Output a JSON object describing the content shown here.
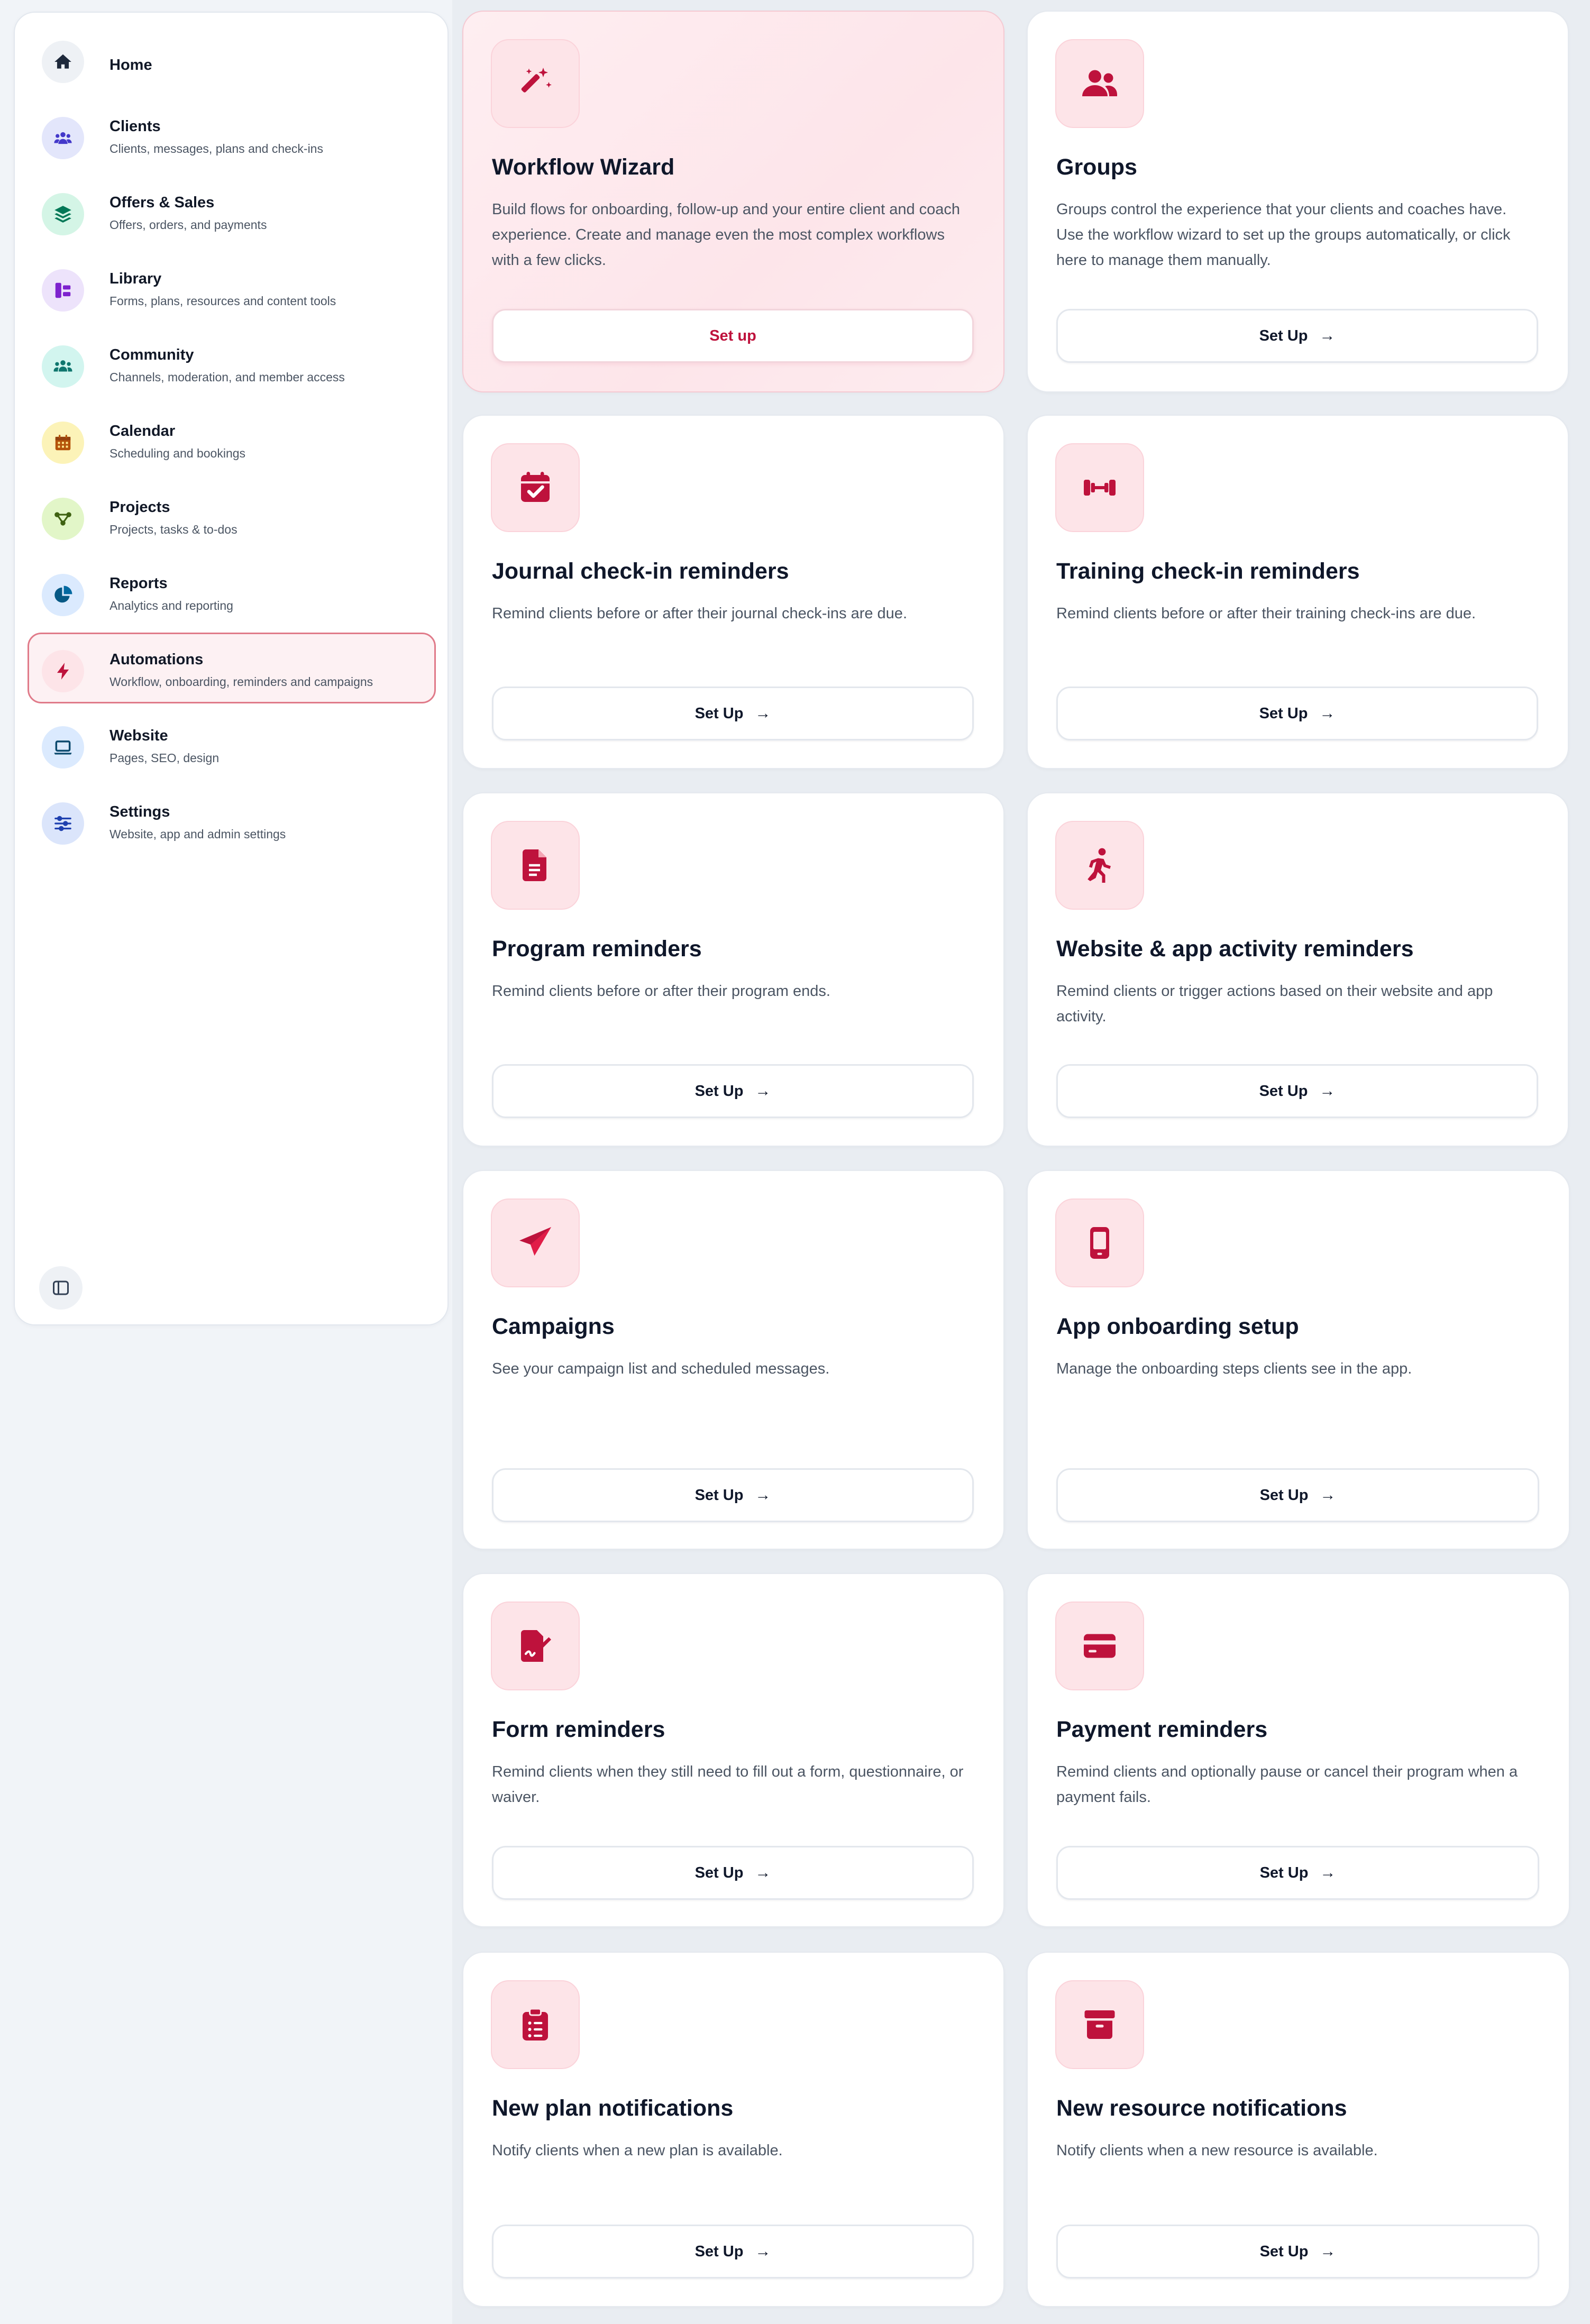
{
  "colors": {
    "accent": "#c8102e",
    "accent_soft": "#fde4e8",
    "active_border": "#e07a89"
  },
  "sidebar": {
    "items": [
      {
        "title": "Home",
        "subtitle": "",
        "icon": "home-icon"
      },
      {
        "title": "Clients",
        "subtitle": "Clients, messages, plans and check-ins",
        "icon": "users-icon"
      },
      {
        "title": "Offers & Sales",
        "subtitle": "Offers, orders, and payments",
        "icon": "layers-icon"
      },
      {
        "title": "Library",
        "subtitle": "Forms, plans, resources and content tools",
        "icon": "library-icon"
      },
      {
        "title": "Community",
        "subtitle": "Channels, moderation, and member access",
        "icon": "community-icon"
      },
      {
        "title": "Calendar",
        "subtitle": "Scheduling and bookings",
        "icon": "calendar-icon"
      },
      {
        "title": "Projects",
        "subtitle": "Projects, tasks & to-dos",
        "icon": "projects-icon"
      },
      {
        "title": "Reports",
        "subtitle": "Analytics and reporting",
        "icon": "pie-chart-icon"
      },
      {
        "title": "Automations",
        "subtitle": "Workflow, onboarding, reminders and campaigns",
        "icon": "bolt-icon"
      },
      {
        "title": "Website",
        "subtitle": "Pages, SEO, design",
        "icon": "laptop-icon"
      },
      {
        "title": "Settings",
        "subtitle": "Website, app and admin settings",
        "icon": "sliders-icon"
      }
    ],
    "active": "Automations"
  },
  "cards": [
    {
      "title": "Workflow Wizard",
      "description": "Build flows for onboarding, follow-up and your entire client and coach experience. Create and manage even the most complex workflows with a few clicks.",
      "button": "Set up",
      "icon": "magic-wand-icon"
    },
    {
      "title": "Groups",
      "description": "Groups control the experience that your clients and coaches have. Use the workflow wizard to set up the groups automatically, or click here to manage them manually.",
      "button": "Set Up",
      "icon": "user-group-icon"
    },
    {
      "title": "Journal check-in reminders",
      "description": "Remind clients before or after their journal check-ins are due.",
      "button": "Set Up",
      "icon": "calendar-check-icon"
    },
    {
      "title": "Training check-in reminders",
      "description": "Remind clients before or after their training check-ins are due.",
      "button": "Set Up",
      "icon": "dumbbell-icon"
    },
    {
      "title": "Program reminders",
      "description": "Remind clients before or after their program ends.",
      "button": "Set Up",
      "icon": "document-icon"
    },
    {
      "title": "Website & app activity reminders",
      "description": "Remind clients or trigger actions based on their website and app activity.",
      "button": "Set Up",
      "icon": "walking-icon"
    },
    {
      "title": "Campaigns",
      "description": "See your campaign list and scheduled messages.",
      "button": "Set Up",
      "icon": "paper-plane-icon"
    },
    {
      "title": "App onboarding setup",
      "description": "Manage the onboarding steps clients see in the app.",
      "button": "Set Up",
      "icon": "mobile-icon"
    },
    {
      "title": "Form reminders",
      "description": "Remind clients when they still need to fill out a form, questionnaire, or waiver.",
      "button": "Set Up",
      "icon": "form-signature-icon"
    },
    {
      "title": "Payment reminders",
      "description": "Remind clients and optionally pause or cancel their program when a payment fails.",
      "button": "Set Up",
      "icon": "credit-card-icon"
    },
    {
      "title": "New plan notifications",
      "description": "Notify clients when a new plan is available.",
      "button": "Set Up",
      "icon": "clipboard-list-icon"
    },
    {
      "title": "New resource notifications",
      "description": "Notify clients when a new resource is available.",
      "button": "Set Up",
      "icon": "archive-box-icon"
    }
  ]
}
